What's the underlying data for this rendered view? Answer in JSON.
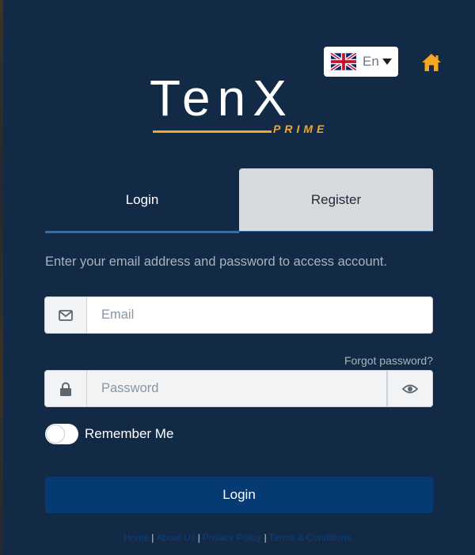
{
  "header": {
    "language": {
      "label": "En",
      "flag_icon": "uk-flag-icon"
    },
    "home_icon": "home-icon"
  },
  "logo": {
    "main": "TenX",
    "sub": "PRIME"
  },
  "tabs": [
    {
      "label": "Login",
      "active": true
    },
    {
      "label": "Register",
      "active": false
    }
  ],
  "form": {
    "intro": "Enter your email address and password to access account.",
    "email_placeholder": "Email",
    "password_placeholder": "Password",
    "forgot_label": "Forgot password?",
    "remember_label": "Remember Me",
    "remember_checked": false,
    "submit_label": "Login"
  },
  "footer": {
    "links": [
      "Home",
      "About Us",
      "Privacy Policy",
      "Terms & Conditions"
    ]
  },
  "colors": {
    "background": "#132a46",
    "accent": "#f5a623",
    "button": "#053b72",
    "tab_inactive": "#d6dadd"
  }
}
